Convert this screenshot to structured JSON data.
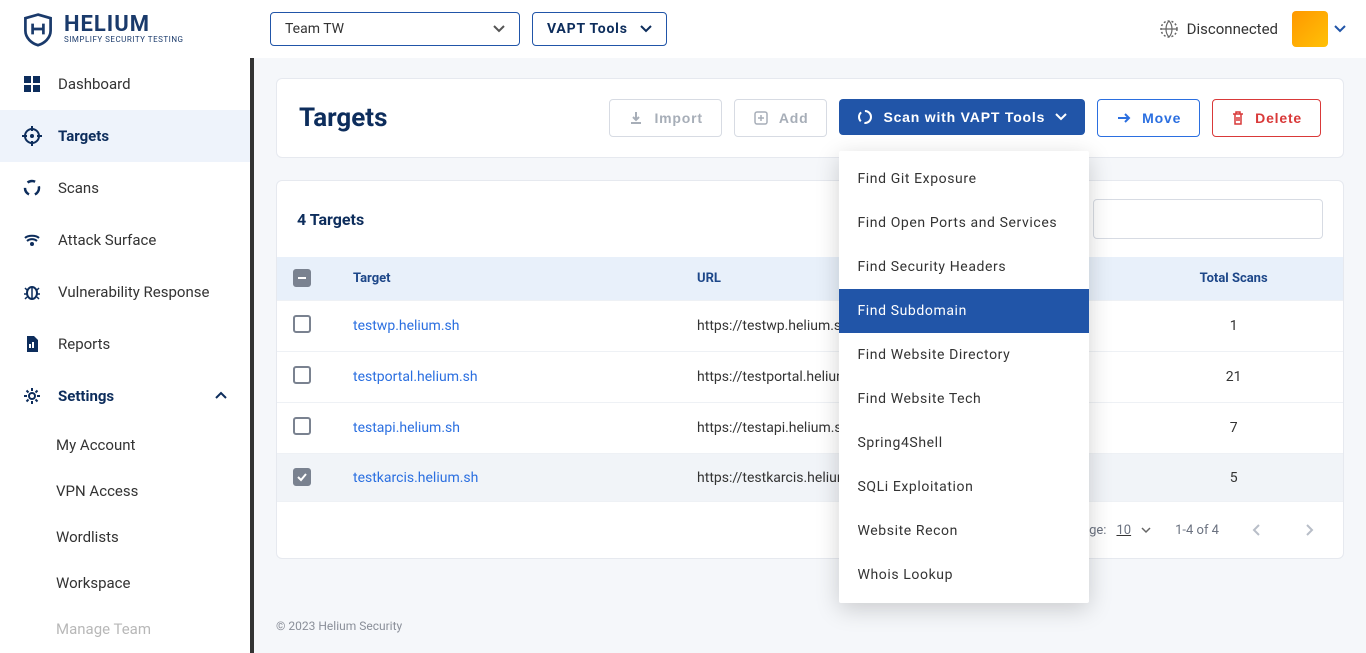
{
  "logo": {
    "main": "HELIUM",
    "sub": "SIMPLIFY SECURITY TESTING"
  },
  "topbar": {
    "team": "Team TW",
    "tools_label": "VAPT Tools",
    "conn_status": "Disconnected"
  },
  "sidebar": {
    "items": [
      {
        "label": "Dashboard"
      },
      {
        "label": "Targets"
      },
      {
        "label": "Scans"
      },
      {
        "label": "Attack Surface"
      },
      {
        "label": "Vulnerability Response"
      },
      {
        "label": "Reports"
      },
      {
        "label": "Settings"
      }
    ],
    "sub": [
      {
        "label": "My Account"
      },
      {
        "label": "VPN Access"
      },
      {
        "label": "Wordlists"
      },
      {
        "label": "Workspace"
      },
      {
        "label": "Manage Team"
      }
    ]
  },
  "page": {
    "title": "Targets"
  },
  "actions": {
    "import": "Import",
    "add": "Add",
    "scan": "Scan with VAPT Tools",
    "move": "Move",
    "delete": "Delete"
  },
  "scan_menu": [
    "Find Git Exposure",
    "Find Open Ports and Services",
    "Find Security Headers",
    "Find Subdomain",
    "Find Website Directory",
    "Find Website Tech",
    "Spring4Shell",
    "SQLi Exploitation",
    "Website Recon",
    "Whois Lookup"
  ],
  "scan_menu_highlight": 3,
  "table": {
    "count_label": "4 Targets",
    "search_placeholder": "",
    "headers": {
      "target": "Target",
      "url": "URL",
      "scans": "Total Scans"
    },
    "rows": [
      {
        "checked": false,
        "target": "testwp.helium.sh",
        "url": "https://testwp.helium.sh",
        "scans": "1"
      },
      {
        "checked": false,
        "target": "testportal.helium.sh",
        "url": "https://testportal.helium.sh",
        "scans": "21"
      },
      {
        "checked": false,
        "target": "testapi.helium.sh",
        "url": "https://testapi.helium.sh",
        "scans": "7"
      },
      {
        "checked": true,
        "target": "testkarcis.helium.sh",
        "url": "https://testkarcis.helium.sh",
        "scans": "5"
      }
    ],
    "pager": {
      "ipp_label": "Items per page:",
      "ipp_value": "10",
      "range": "1-4 of 4"
    }
  },
  "footer": "© 2023 Helium Security"
}
